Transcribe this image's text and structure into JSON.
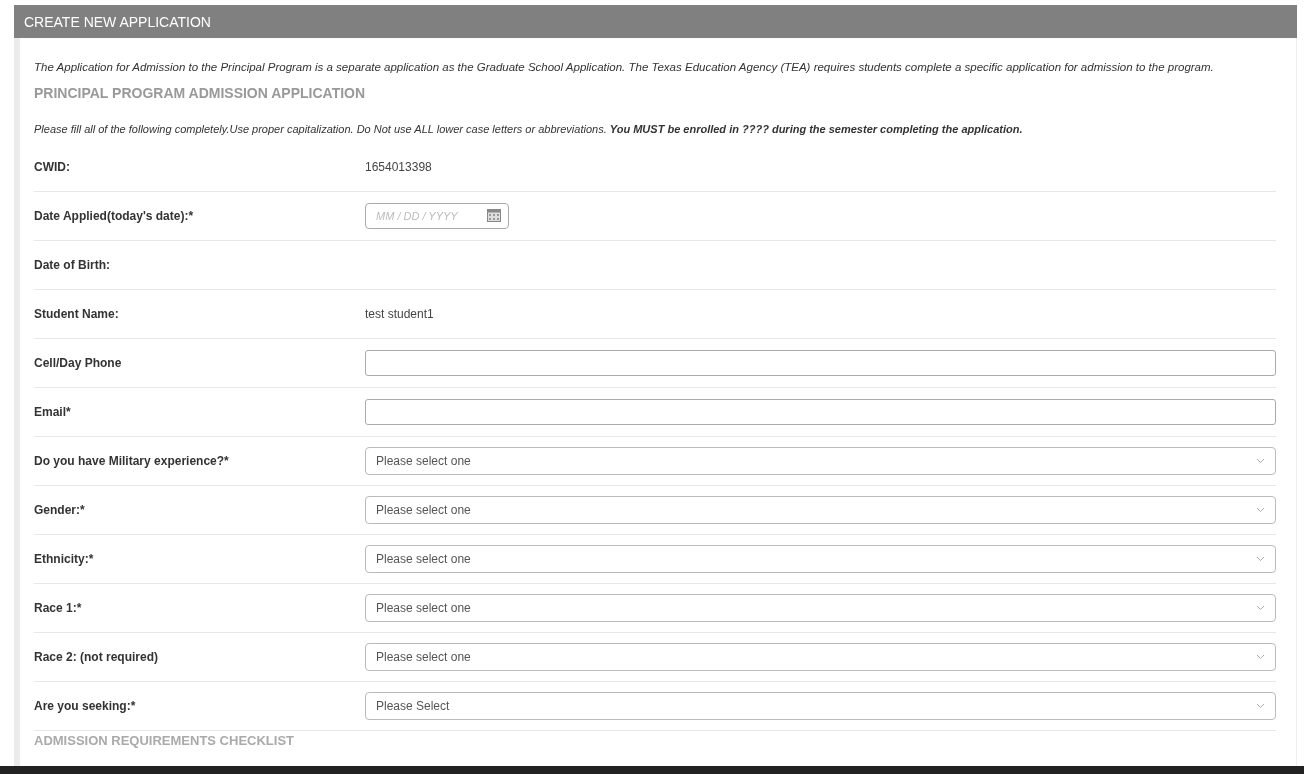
{
  "header": {
    "title": "CREATE NEW APPLICATION"
  },
  "intro": "The Application for Admission to the Principal Program is a separate application as the Graduate School Application. The Texas Education Agency (TEA) requires students complete a specific application for admission to the program.",
  "section_title": "PRINCIPAL PROGRAM ADMISSION APPLICATION",
  "instructions": "Please fill all of the following completely.Use proper capitalization. Do Not use ALL lower case letters or abbreviations. **You MUST be enrolled in ???? during the semester completing the application.**",
  "rows": [
    {
      "label": "CWID:",
      "kind": "text",
      "value": "1654013398"
    },
    {
      "label": "Date Applied(today's date):*",
      "kind": "date",
      "placeholder": "MM / DD / YYYY"
    },
    {
      "label": "Date of Birth:",
      "kind": "none"
    },
    {
      "label": "Student Name:",
      "kind": "text",
      "value": "test student1"
    },
    {
      "label": "Cell/Day Phone",
      "kind": "input"
    },
    {
      "label": "Email*",
      "kind": "input"
    },
    {
      "label": "Do you have Military experience?*",
      "kind": "select",
      "value": "Please select one"
    },
    {
      "label": "Gender:*",
      "kind": "select",
      "value": "Please select one"
    },
    {
      "label": "Ethnicity:*",
      "kind": "select",
      "value": "Please select one"
    },
    {
      "label": "Race 1:*",
      "kind": "select",
      "value": "Please select one"
    },
    {
      "label": "Race 2: (not required)",
      "kind": "select",
      "value": "Please select one"
    },
    {
      "label": "Are you seeking:*",
      "kind": "select",
      "value": "Please Select"
    }
  ],
  "next_section_title": "ADMISSION REQUIREMENTS CHECKLIST"
}
